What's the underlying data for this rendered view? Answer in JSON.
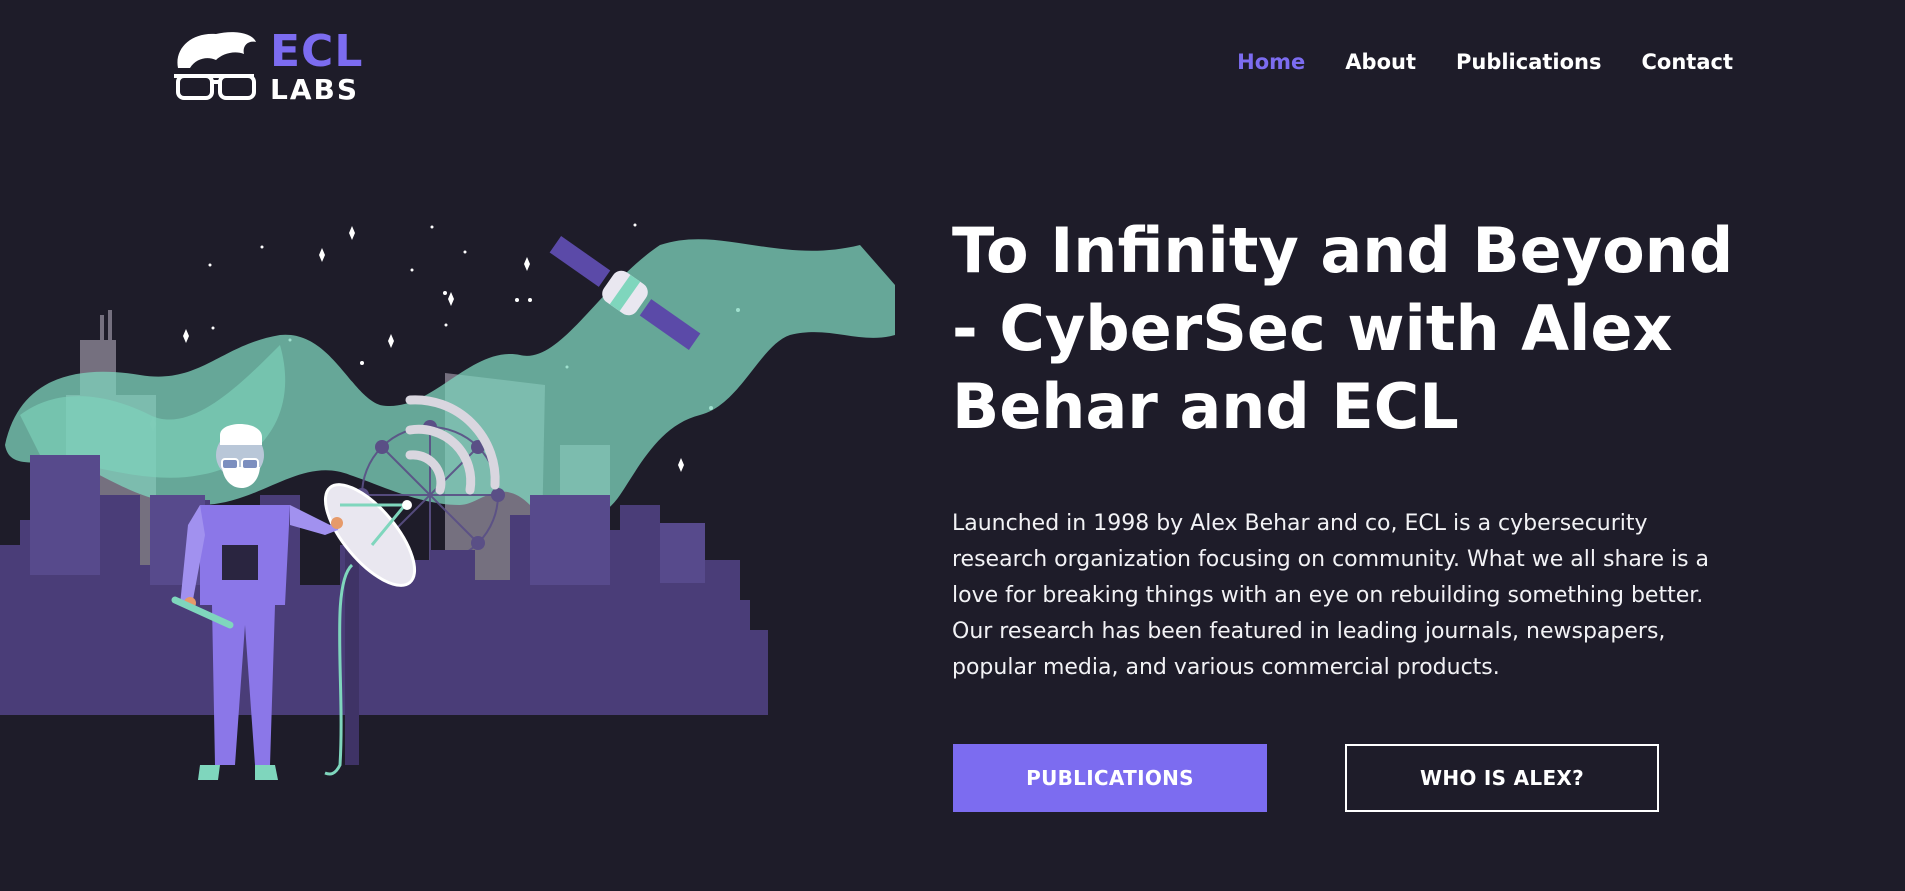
{
  "brand": {
    "logo_top": "ECL",
    "logo_bottom": "LABS",
    "icon": "hair-glasses-logo-icon",
    "accent_color": "#7c6cf0"
  },
  "nav": {
    "items": [
      {
        "label": "Home",
        "active": true
      },
      {
        "label": "About",
        "active": false
      },
      {
        "label": "Publications",
        "active": false
      },
      {
        "label": "Contact",
        "active": false
      }
    ]
  },
  "hero": {
    "title": "To Infinity and Beyond - CyberSec with Alex Behar and ECL",
    "description": "Launched in 1998 by Alex Behar and co, ECL is a cybersecurity research organization focusing on community. What we all share is a love for breaking things with an eye on rebuilding something better. Our research has been featured in leading journals, newspapers, popular media, and various commercial products.",
    "primary_button": "PUBLICATIONS",
    "secondary_button": "WHO IS ALEX?"
  },
  "illustration": {
    "icon": "city-satellite-scientist-illustration",
    "colors": {
      "city": "#4a3d78",
      "aurora": "#7fd6bd",
      "figure": "#8b77e8"
    }
  }
}
